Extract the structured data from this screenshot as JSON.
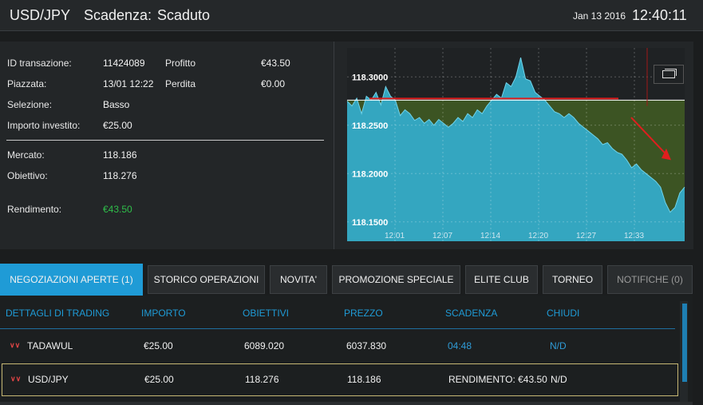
{
  "header": {
    "pair": "USD/JPY",
    "expiry_label": "Scadenza:",
    "expiry_value": "Scaduto",
    "date": "Jan 13 2016",
    "time": "12:40:11"
  },
  "details": {
    "transaction_id_label": "ID transazione:",
    "transaction_id": "11424089",
    "placed_label": "Piazzata:",
    "placed": "13/01 12:22",
    "selection_label": "Selezione:",
    "selection": "Basso",
    "invested_label": "Importo investito:",
    "invested": "€25.00",
    "profit_label": "Profitto",
    "profit": "€43.50",
    "loss_label": "Perdita",
    "loss": "€0.00",
    "market_label": "Mercato:",
    "market": "118.186",
    "target_label": "Obiettivo:",
    "target": "118.276",
    "return_label": "Rendimento:",
    "return": "€43.50"
  },
  "chart_data": {
    "type": "area",
    "y_ticks": [
      "118.3000",
      "118.2500",
      "118.2000",
      "118.1500"
    ],
    "x_ticks": [
      "12:01",
      "12:07",
      "12:14",
      "12:20",
      "12:27",
      "12:33"
    ],
    "ylim": [
      118.13,
      118.33
    ],
    "target_level": 118.276,
    "series": [
      {
        "values": [
          118.275,
          118.27,
          118.278,
          118.262,
          118.28,
          118.276,
          118.284,
          118.271,
          118.29,
          118.28,
          118.276,
          118.26,
          118.266,
          118.262,
          118.255,
          118.258,
          118.252,
          118.256,
          118.25,
          118.256,
          118.252,
          118.248,
          118.252,
          118.258,
          118.254,
          118.262,
          118.258,
          118.266,
          118.262,
          118.27,
          118.276,
          118.282,
          118.278,
          118.294,
          118.29,
          118.3,
          118.32,
          118.298,
          118.296,
          118.284,
          118.28,
          118.276,
          118.27,
          118.264,
          118.262,
          118.258,
          118.262,
          118.258,
          118.252,
          118.248,
          118.244,
          118.24,
          118.236,
          118.23,
          118.232,
          118.226,
          118.222,
          118.22,
          118.214,
          118.206,
          118.21,
          118.204,
          118.2,
          118.196,
          118.192,
          118.186,
          118.17,
          118.16,
          118.165,
          118.18,
          118.186
        ]
      }
    ],
    "grid": true,
    "colors": {
      "fill_below": "#34a6c0",
      "fill_above": "#3f5a23",
      "target_line": "#e01e1e",
      "arrow": "#e01e1e"
    }
  },
  "tabs": [
    {
      "label": "NEGOZIAZIONI APERTE (1)"
    },
    {
      "label": "STORICO OPERAZIONI"
    },
    {
      "label": "NOVITA'"
    },
    {
      "label": "PROMOZIONE SPECIALE"
    },
    {
      "label": "ELITE CLUB"
    },
    {
      "label": "TORNEO"
    },
    {
      "label": "NOTIFICHE (0)"
    }
  ],
  "table": {
    "columns": [
      "DETTAGLI DI TRADING",
      "IMPORTO",
      "OBIETTIVI",
      "PREZZO",
      "SCADENZA",
      "CHIUDI"
    ],
    "rows": [
      {
        "asset": "TADAWUL",
        "amount": "€25.00",
        "target": "6089.020",
        "price": "6037.830",
        "expiry": "04:48",
        "close": "N/D"
      },
      {
        "asset": "USD/JPY",
        "amount": "€25.00",
        "target": "118.276",
        "price": "118.186",
        "expiry": "RENDIMENTO: €43.50",
        "close": "N/D"
      }
    ]
  },
  "colors": {
    "accent": "#1f9bd6",
    "positive": "#2fbf4a",
    "down": "#e04545"
  }
}
